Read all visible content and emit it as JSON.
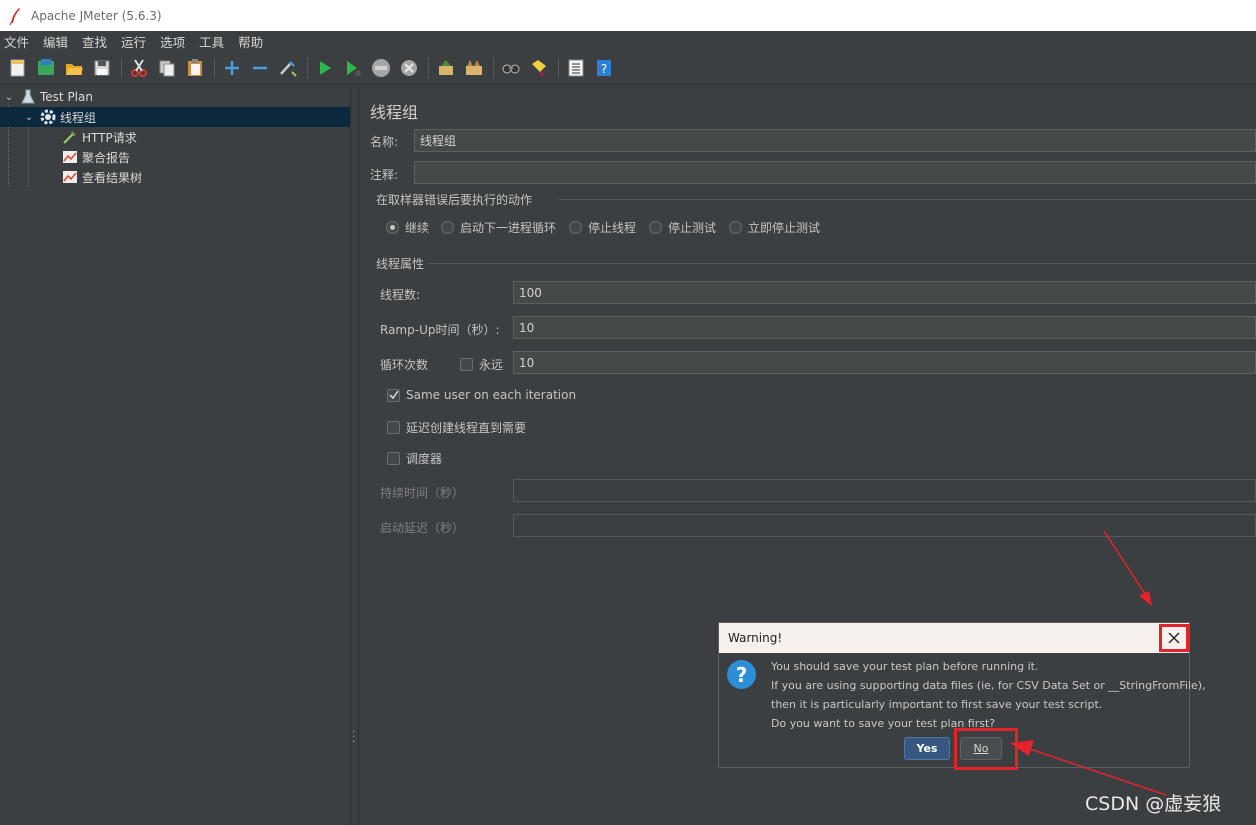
{
  "window": {
    "title": "Apache JMeter (5.6.3)"
  },
  "menu": [
    "文件",
    "编辑",
    "查找",
    "运行",
    "选项",
    "工具",
    "帮助"
  ],
  "toolbar": {
    "icons": [
      "new-icon",
      "templates-icon",
      "open-icon",
      "save-icon",
      "cut-icon",
      "copy-icon",
      "paste-icon",
      "expand-icon",
      "collapse-icon",
      "toggle-icon",
      "start-icon",
      "start-no-pause-icon",
      "stop-icon",
      "shutdown-icon",
      "clear-icon",
      "clear-all-icon",
      "search-icon",
      "reset-search-icon",
      "function-helper-icon",
      "help-icon"
    ]
  },
  "tree": {
    "items": [
      {
        "label": "Test Plan",
        "icon": "flask-icon"
      },
      {
        "label": "线程组",
        "icon": "gear-icon"
      },
      {
        "label": "HTTP请求",
        "icon": "pipette-icon"
      },
      {
        "label": "聚合报告",
        "icon": "graph-icon"
      },
      {
        "label": "查看结果树",
        "icon": "graph-icon"
      }
    ]
  },
  "panel": {
    "heading": "线程组",
    "name_label": "名称:",
    "name_value": "线程组",
    "comment_label": "注释:",
    "comment_value": "",
    "error_group_title": "在取样器错误后要执行的动作",
    "error_actions": [
      "继续",
      "启动下一进程循环",
      "停止线程",
      "停止测试",
      "立即停止测试"
    ],
    "error_selected": "继续",
    "thread_group_title": "线程属性",
    "threads_label": "线程数:",
    "threads_value": "100",
    "rampup_label": "Ramp-Up时间（秒）:",
    "rampup_value": "10",
    "loop_label": "循环次数",
    "forever_label": "永远",
    "forever_checked": false,
    "loop_value": "10",
    "same_user_label": "Same user on each iteration",
    "same_user_checked": true,
    "delay_label": "延迟创建线程直到需要",
    "delay_checked": false,
    "scheduler_label": "调度器",
    "scheduler_checked": false,
    "duration_label": "持续时间（秒）",
    "startup_delay_label": "启动延迟（秒）"
  },
  "dialog": {
    "title": "Warning!",
    "lines": [
      "You should save your test plan before running it.",
      "If you are using supporting data files (ie, for CSV Data Set or __StringFromFile),",
      "then it is particularly important to first save your test script.",
      "Do you want to save your test plan first?"
    ],
    "yes_label": "Yes",
    "no_label": "No"
  },
  "watermark": "CSDN @虚妄狼",
  "colors": {
    "annotation": "#e3232c",
    "selected_row": "#0d293e",
    "primary_button": "#365880"
  }
}
